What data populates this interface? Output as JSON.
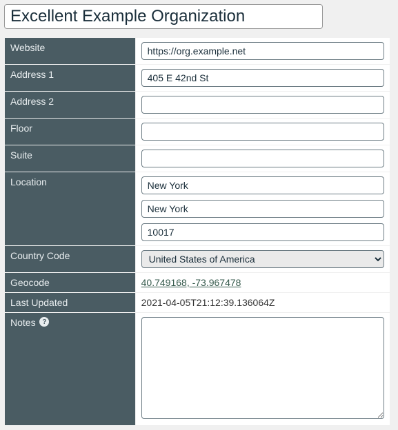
{
  "title": "Excellent Example Organization",
  "fields": {
    "website": {
      "label": "Website",
      "value": "https://org.example.net"
    },
    "address1": {
      "label": "Address 1",
      "value": "405 E 42nd St"
    },
    "address2": {
      "label": "Address 2",
      "value": ""
    },
    "floor": {
      "label": "Floor",
      "value": ""
    },
    "suite": {
      "label": "Suite",
      "value": ""
    },
    "location": {
      "label": "Location",
      "city": "New York",
      "state": "New York",
      "postal": "10017"
    },
    "country": {
      "label": "Country Code",
      "selected": "United States of America"
    },
    "geocode": {
      "label": "Geocode",
      "text": "40.749168, -73.967478"
    },
    "last_updated": {
      "label": "Last Updated",
      "value": "2021-04-05T21:12:39.136064Z"
    },
    "notes": {
      "label": "Notes",
      "value": "",
      "help_glyph": "?"
    }
  }
}
